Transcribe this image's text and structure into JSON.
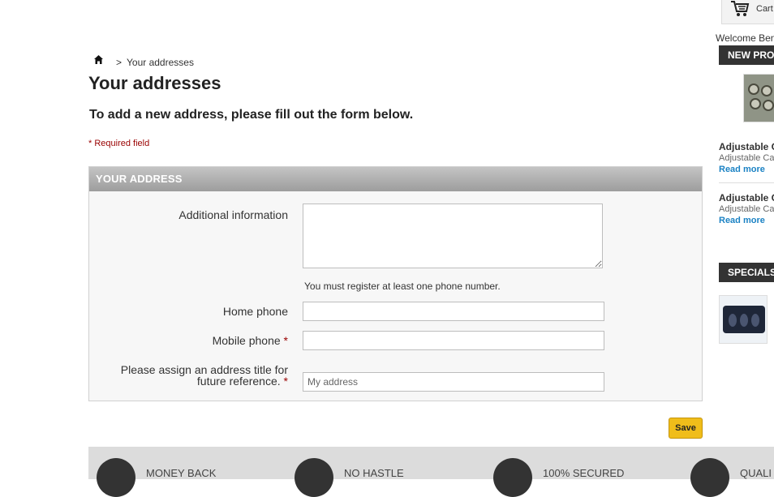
{
  "header": {
    "cart_label": "Cart",
    "welcome_text": "Welcome Ben"
  },
  "breadcrumb": {
    "separator": ">",
    "current": "Your addresses"
  },
  "page": {
    "title": "Your addresses",
    "subtitle": "To add a new address, please fill out the form below.",
    "required_note": "* Required field"
  },
  "form": {
    "section_title": "YOUR ADDRESS",
    "additional_info_label": "Additional information",
    "additional_info_value": "",
    "phone_note": "You must register at least one phone number.",
    "home_phone_label": "Home phone",
    "home_phone_value": "",
    "mobile_phone_label": "Mobile phone",
    "mobile_phone_value": "",
    "alias_label_line1": "Please assign an address title for",
    "alias_label_line2": "future reference.",
    "alias_placeholder": "My address",
    "required_mark": "*",
    "save_label": "Save"
  },
  "sidebar": {
    "new_products_title": "NEW PRODUCTS",
    "products": [
      {
        "name": "Adjustable C",
        "desc": "Adjustable Ca",
        "link": "Read more"
      },
      {
        "name": "Adjustable C",
        "desc": "Adjustable Ca",
        "link": "Read more"
      }
    ],
    "specials_title": "SPECIALS"
  },
  "footer": {
    "items": [
      {
        "label": "MONEY BACK"
      },
      {
        "label": "NO HASTLE"
      },
      {
        "label": "100% SECURED"
      },
      {
        "label": "QUALI"
      }
    ]
  },
  "colors": {
    "accent_button": "#f0bd1a",
    "link": "#1b82c4",
    "required": "#990000",
    "section_header": "#333333"
  }
}
